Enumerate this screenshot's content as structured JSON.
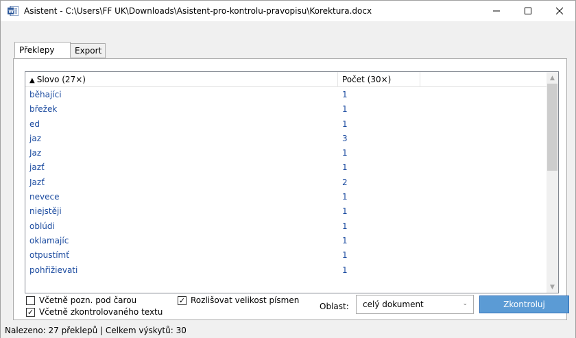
{
  "window": {
    "title": "Asistent - C:\\Users\\FF UK\\Downloads\\Asistent-pro-kontrolu-pravopisu\\Korektura.docx",
    "minimize": "—",
    "maximize": "☐",
    "close": "✕",
    "icon": "word-icon"
  },
  "tabs": [
    {
      "label": "Překlepy",
      "active": true
    },
    {
      "label": "Export",
      "active": false
    }
  ],
  "list": {
    "columns": [
      {
        "label": "Slovo (27×)",
        "sort": "▲"
      },
      {
        "label": "Počet (30×)"
      }
    ],
    "rows": [
      {
        "word": "běhajíci",
        "count": "1"
      },
      {
        "word": "břežek",
        "count": "1"
      },
      {
        "word": "ed",
        "count": "1"
      },
      {
        "word": "jaz",
        "count": "3"
      },
      {
        "word": "Jaz",
        "count": "1"
      },
      {
        "word": "jazť",
        "count": "1"
      },
      {
        "word": "Jazť",
        "count": "2"
      },
      {
        "word": "nevece",
        "count": "1"
      },
      {
        "word": "niejstěji",
        "count": "1"
      },
      {
        "word": "oblúdi",
        "count": "1"
      },
      {
        "word": "oklamajíc",
        "count": "1"
      },
      {
        "word": "otpustímť",
        "count": "1"
      },
      {
        "word": "pohřižievati",
        "count": "1"
      }
    ],
    "scroll_up": "▲",
    "scroll_down": "▼"
  },
  "options": {
    "footnotes": {
      "label": "Včetně pozn. pod čarou",
      "checked": false
    },
    "checked_text": {
      "label": "Včetně zkontrolovaného textu",
      "checked": true
    },
    "case_sensitive": {
      "label": "Rozlišovat velikost písmen",
      "checked": true
    },
    "check_mark": "✓"
  },
  "oblast": {
    "label": "Oblast:",
    "value": "celý dokument",
    "arrow": "⌄"
  },
  "check_button": "Zkontroluj",
  "status": "Nalezeno: 27 překlepů | Celkem výskytů: 30",
  "colors": {
    "link_blue": "#1a4a9f",
    "button_blue": "#5b9bd5"
  }
}
